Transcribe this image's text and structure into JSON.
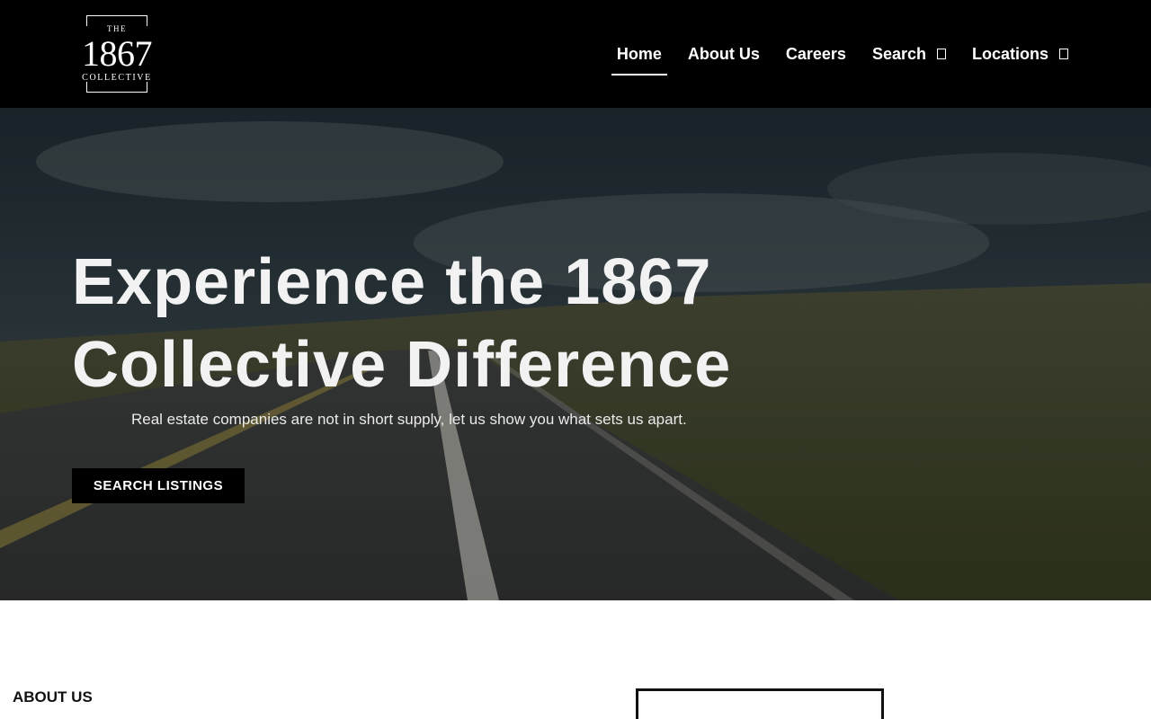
{
  "header": {
    "logo": {
      "top": "THE",
      "number": "1867",
      "bottom": "COLLECTIVE"
    },
    "nav": [
      {
        "label": "Home",
        "active": true,
        "has_dropdown": false
      },
      {
        "label": "About Us",
        "active": false,
        "has_dropdown": false
      },
      {
        "label": "Careers",
        "active": false,
        "has_dropdown": false
      },
      {
        "label": "Search",
        "active": false,
        "has_dropdown": true
      },
      {
        "label": "Locations",
        "active": false,
        "has_dropdown": true
      }
    ]
  },
  "hero": {
    "title_line1": "Experience the 1867",
    "title_line2": "Collective Difference",
    "subtitle": "Real estate companies are not in short supply, let us show you what sets us apart.",
    "button_label": "SEARCH LISTINGS"
  },
  "about": {
    "kicker": "ABOUT US"
  },
  "colors": {
    "header_bg": "#000000",
    "hero_text": "#f2f2f2",
    "button_bg": "#000000",
    "page_bg": "#ffffff"
  }
}
